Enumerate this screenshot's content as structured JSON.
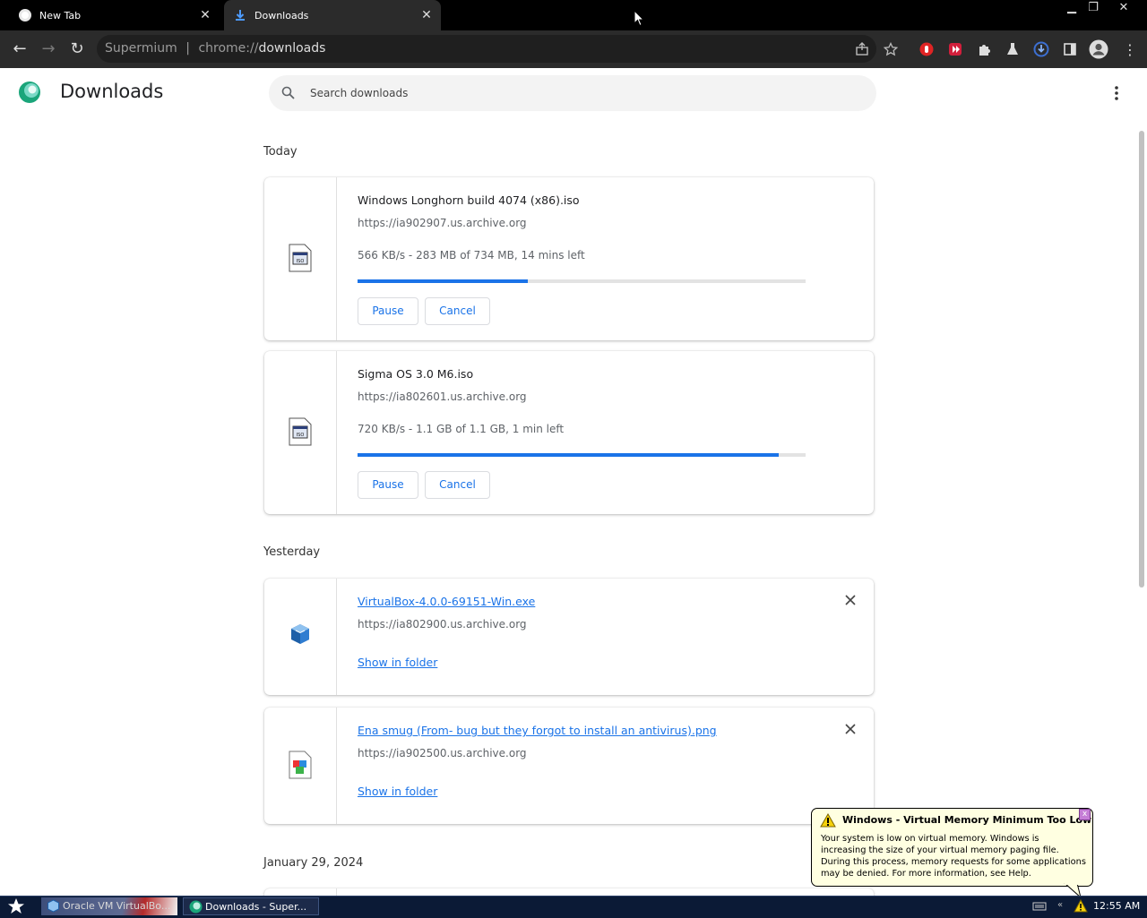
{
  "browser": {
    "tabs": [
      {
        "title": "New Tab"
      },
      {
        "title": "Downloads"
      }
    ],
    "address": {
      "site_label": "Supermium",
      "separator": "|",
      "scheme": "chrome://",
      "path": "downloads"
    }
  },
  "page": {
    "title": "Downloads",
    "search_placeholder": "Search downloads"
  },
  "sections": {
    "today": "Today",
    "yesterday": "Yesterday",
    "older": "January 29, 2024"
  },
  "downloads": [
    {
      "name": "Windows Longhorn build 4074 (x86).iso",
      "url": "https://ia902907.us.archive.org",
      "status": "566 KB/s - 283 MB of 734 MB, 14 mins left",
      "progress": 0.38,
      "pause": "Pause",
      "cancel": "Cancel"
    },
    {
      "name": "Sigma OS 3.0 M6.iso",
      "url": "https://ia802601.us.archive.org",
      "status": "720 KB/s - 1.1 GB of 1.1 GB, 1 min left",
      "progress": 0.94,
      "pause": "Pause",
      "cancel": "Cancel"
    },
    {
      "name": "VirtualBox-4.0.0-69151-Win.exe",
      "url": "https://ia802900.us.archive.org",
      "action": "Show in folder"
    },
    {
      "name": "Ena smug (From- bug but they forgot to install an antivirus).png",
      "url": "https://ia902500.us.archive.org",
      "action": "Show in folder"
    }
  ],
  "balloon": {
    "title": "Windows - Virtual Memory Minimum Too Low",
    "body": "Your system is low on virtual memory. Windows is increasing the size of your virtual memory paging file. During this process, memory requests for some applications may be denied. For more information, see Help.",
    "close": "x"
  },
  "taskbar": {
    "items": [
      {
        "label": "Oracle VM VirtualBo..."
      },
      {
        "label": "Downloads - Super..."
      }
    ],
    "clock": "12:55 AM"
  },
  "colors": {
    "accent": "#1a73e8",
    "balloon_bg": "#ffffe1",
    "taskbar": "#0b1a36"
  }
}
